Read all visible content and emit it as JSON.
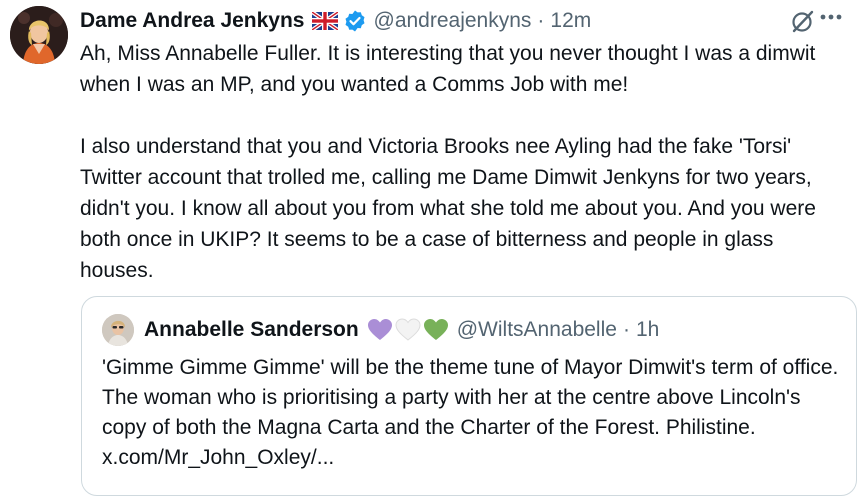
{
  "tweet": {
    "author_name": "Dame Andrea Jenkyns",
    "handle": "@andreajenkyns",
    "separator": "·",
    "time": "12m",
    "icons": {
      "avatar": "profile-photo",
      "flag": "uk-flag-icon",
      "verified": "verified-badge-icon",
      "grok": "grok-icon",
      "more": "more-options-icon"
    },
    "paragraph_1": "Ah, Miss Annabelle Fuller. It is interesting that you never thought I was a dimwit when I was an MP, and you wanted a Comms Job with me!",
    "paragraph_2": "I also understand that you and Victoria Brooks nee Ayling  had the fake 'Torsi' Twitter account that trolled me, calling me Dame Dimwit Jenkyns for two years, didn't you. I know all about you from what she told me about you. And you were both once in UKIP? It seems to be a case of bitterness and people in glass houses."
  },
  "quoted": {
    "author_name": "Annabelle Sanderson",
    "hearts": [
      "purple-heart",
      "white-heart",
      "green-heart"
    ],
    "handle": "@WiltsAnnabelle",
    "separator": "·",
    "time": "1h",
    "text": "'Gimme Gimme Gimme' will be the theme tune of Mayor Dimwit's term of office. The woman who is prioritising a party with her at the centre above Lincoln's copy of both the Magna Carta and the Charter of the Forest. Philistine. x.com/Mr_John_Oxley/..."
  },
  "colors": {
    "text": "#0f1419",
    "secondary": "#536471",
    "verified": "#1d9bf0",
    "border": "#cfd9de",
    "heart_purple": "#aa8ed6",
    "heart_white": "#ececec",
    "heart_green": "#78b159"
  }
}
